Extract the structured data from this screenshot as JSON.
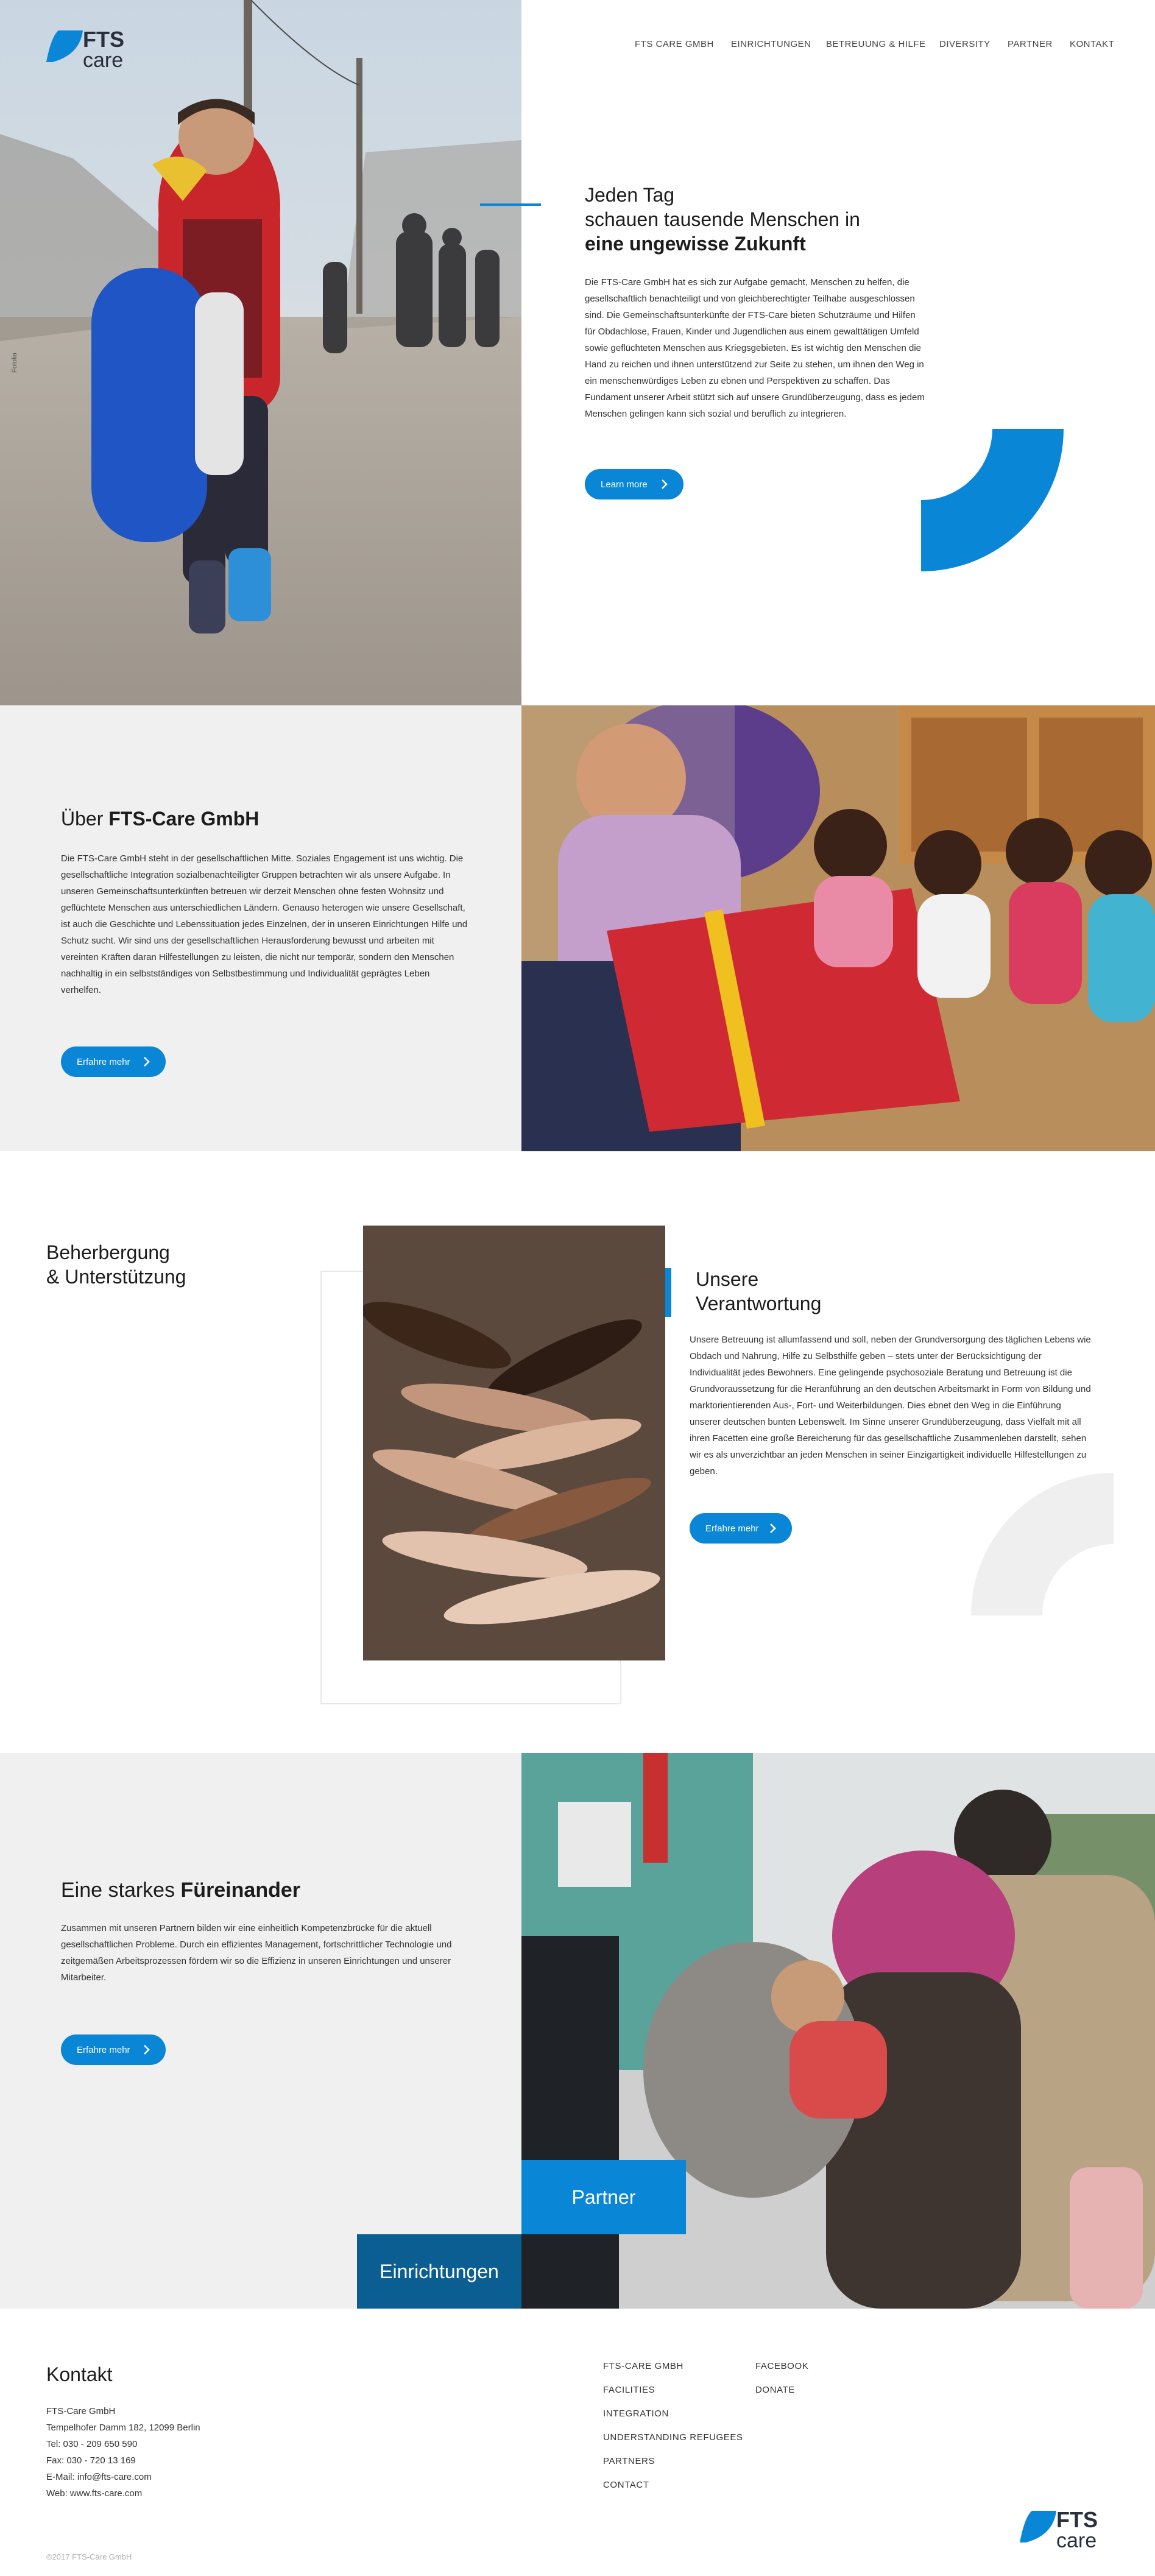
{
  "brand": {
    "logo_top": "FTS",
    "logo_bottom": "care",
    "accent": "#0a86d6",
    "dark_accent": "#0a5e92",
    "panel_grey": "#f0f0f0"
  },
  "nav": [
    {
      "label": "FTS CARE GMBH"
    },
    {
      "label": "EINRICHTUNGEN"
    },
    {
      "label": "BETREUUNG & HILFE"
    },
    {
      "label": "DIVERSITY"
    },
    {
      "label": "PARTNER"
    },
    {
      "label": "KONTAKT"
    }
  ],
  "hero": {
    "photo_credit": "Fotolia",
    "heading_line1": "Jeden Tag",
    "heading_line2": "schauen tausende Menschen in",
    "heading_bold": "eine ungewisse Zukunft",
    "body": "Die FTS-Care GmbH hat es sich zur Aufgabe gemacht, Menschen zu helfen, die gesellschaftlich benachteiligt und von gleichberechtigter Teilhabe ausgeschlossen sind. Die Gemeinschaftsunterkünfte der FTS-Care bieten Schutzräume und Hilfen für Obdachlose, Frauen, Kinder und Jugendlichen aus einem gewalttätigen Umfeld sowie geflüchteten Menschen aus Kriegsgebieten. Es ist wichtig den Menschen die Hand zu reichen und ihnen unterstützend zur Seite zu stehen, um ihnen den Weg in ein menschenwürdiges Leben zu ebnen und Perspektiven zu schaffen. Das Fundament unserer Arbeit stützt sich auf unsere Grundüberzeugung, dass es jedem Menschen gelingen kann sich sozial und beruflich zu integrieren.",
    "button": "Learn more"
  },
  "about": {
    "heading_plain": "Über ",
    "heading_bold": "FTS-Care GmbH",
    "body": "Die FTS-Care GmbH steht in der gesellschaftlichen Mitte. Soziales Engagement ist uns wichtig. Die gesellschaftliche Integration sozialbenachteiligter Gruppen betrachten wir als unsere Aufgabe. In unseren Gemeinschaftsunterkünften betreuen wir derzeit Menschen ohne festen Wohnsitz und geflüchtete Menschen aus unterschiedlichen Ländern. Genauso heterogen wie unsere Gesellschaft, ist auch die Geschichte und Lebenssituation jedes Einzelnen, der in unseren Einrichtungen Hilfe und Schutz sucht. Wir sind uns der gesellschaftlichen Herausforderung bewusst und arbeiten mit vereinten Kräften daran Hilfestellungen zu leisten, die nicht nur temporär, sondern den Menschen nachhaltig in ein selbstständiges von Selbstbestimmung und Individualität geprägtes Leben verhelfen.",
    "button": "Erfahre mehr"
  },
  "support": {
    "side_line1": "Beherbergung",
    "side_line2": "& Unterstützung",
    "heading_line1": "Unsere",
    "heading_line2": "Verantwortung",
    "body": "Unsere Betreuung ist allumfassend und soll, neben der Grundversorgung des täglichen Lebens wie Obdach und Nahrung, Hilfe zu Selbsthilfe geben – stets unter der Berücksichtigung der Individualität jedes Bewohners. Eine gelingende psychosoziale Beratung und Betreuung ist die Grundvoraussetzung für die Heranführung an den deutschen Arbeitsmarkt in Form von Bildung und marktorientierenden Aus-, Fort- und Weiterbildungen. Dies ebnet den Weg in die Einführung unserer deutschen bunten Lebenswelt. Im Sinne unserer Grundüberzeugung, dass Vielfalt mit all ihren Facetten eine große Bereicherung für das gesellschaftliche Zusammenleben darstellt, sehen wir es als unverzichtbar an jeden Menschen in seiner Einzigartigkeit individuelle Hilfestellungen zu geben.",
    "button": "Erfahre mehr"
  },
  "together": {
    "heading_plain": "Eine starkes ",
    "heading_bold": "Füreinander",
    "body": "Zusammen mit unseren Partnern bilden wir eine einheitlich Kompetenzbrücke für die aktuell gesellschaftlichen Probleme. Durch ein effizientes Management, fortschrittlicher Technologie und zeitgemäßen Arbeitsprozessen fördern wir so die Effizienz in unseren Einrichtungen und unserer Mitarbeiter.",
    "button": "Erfahre mehr",
    "tile_partner": "Partner",
    "tile_facilities": "Einrichtungen"
  },
  "footer": {
    "heading": "Kontakt",
    "address": [
      "FTS-Care GmbH",
      "Tempelhofer Damm 182, 12099 Berlin",
      "Tel: 030 - 209 650 590",
      "Fax: 030 - 720 13 169",
      "E-Mail: info@fts-care.com",
      "Web: www.fts-care.com"
    ],
    "links_col1": [
      "FTS-CARE GMBH",
      "FACILITIES",
      "INTEGRATION",
      "UNDERSTANDING REFUGEES",
      "PARTNERS",
      "CONTACT"
    ],
    "links_col2": [
      "FACEBOOK",
      "DONATE"
    ],
    "copyright": "©2017 FTS-Care GmbH"
  }
}
